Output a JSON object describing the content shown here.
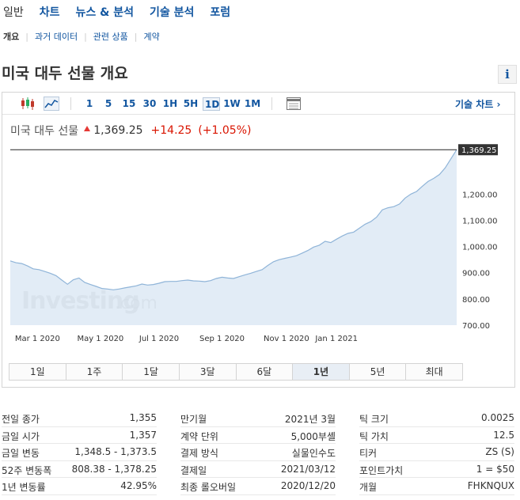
{
  "top_nav": [
    "일반",
    "차트",
    "뉴스 & 분석",
    "기술 분석",
    "포럼"
  ],
  "sub_nav": [
    "개요",
    "과거 데이터",
    "관련 상품",
    "계약"
  ],
  "page_title": "미국 대두 선물 개요",
  "info_label": "i",
  "toolbar": {
    "timeframes": [
      "1",
      "5",
      "15",
      "30",
      "1H",
      "5H",
      "1D",
      "1W",
      "1M"
    ],
    "active_timeframe": "1D",
    "tech_chart_label": "기술 차트 ›"
  },
  "quote": {
    "name": "미국 대두 선물",
    "price": "1,369.25",
    "change": "+14.25",
    "change_pct": "(+1.05%)"
  },
  "colors": {
    "link": "#1256a0",
    "up": "#d91400",
    "area_fill": "#dde9f5",
    "line": "#8fb4d8"
  },
  "chart_data": {
    "type": "area",
    "x_labels": [
      "Mar 1 2020",
      "May 1 2020",
      "Jul 1 2020",
      "Sep 1 2020",
      "Nov 1 2020",
      "Jan 1 2021"
    ],
    "y_ticks": [
      "700.00",
      "800.00",
      "900.00",
      "1,000.00",
      "1,100.00",
      "1,200.00"
    ],
    "ylim": [
      700,
      1370
    ],
    "last_label": "1,369.25",
    "watermark": "Investing.com",
    "series": [
      {
        "values": [
          [
            0,
            945
          ],
          [
            4,
            938
          ],
          [
            8,
            935
          ],
          [
            12,
            926
          ],
          [
            16,
            915
          ],
          [
            20,
            912
          ],
          [
            24,
            905
          ],
          [
            28,
            898
          ],
          [
            32,
            889
          ],
          [
            36,
            872
          ],
          [
            40,
            856
          ],
          [
            44,
            873
          ],
          [
            48,
            880
          ],
          [
            52,
            863
          ],
          [
            56,
            855
          ],
          [
            60,
            848
          ],
          [
            64,
            840
          ],
          [
            68,
            838
          ],
          [
            72,
            835
          ],
          [
            76,
            838
          ],
          [
            80,
            842
          ],
          [
            84,
            846
          ],
          [
            88,
            850
          ],
          [
            92,
            857
          ],
          [
            96,
            853
          ],
          [
            100,
            855
          ],
          [
            104,
            860
          ],
          [
            108,
            866
          ],
          [
            112,
            867
          ],
          [
            116,
            867
          ],
          [
            120,
            870
          ],
          [
            124,
            872
          ],
          [
            128,
            869
          ],
          [
            132,
            868
          ],
          [
            136,
            866
          ],
          [
            140,
            870
          ],
          [
            144,
            878
          ],
          [
            148,
            883
          ],
          [
            152,
            880
          ],
          [
            156,
            878
          ],
          [
            160,
            885
          ],
          [
            164,
            892
          ],
          [
            168,
            898
          ],
          [
            172,
            905
          ],
          [
            176,
            912
          ],
          [
            180,
            928
          ],
          [
            184,
            942
          ],
          [
            188,
            950
          ],
          [
            192,
            955
          ],
          [
            196,
            960
          ],
          [
            200,
            965
          ],
          [
            204,
            975
          ],
          [
            208,
            985
          ],
          [
            212,
            998
          ],
          [
            216,
            1005
          ],
          [
            220,
            1020
          ],
          [
            224,
            1015
          ],
          [
            228,
            1028
          ],
          [
            232,
            1040
          ],
          [
            236,
            1050
          ],
          [
            240,
            1055
          ],
          [
            244,
            1070
          ],
          [
            248,
            1085
          ],
          [
            252,
            1095
          ],
          [
            256,
            1112
          ],
          [
            260,
            1140
          ],
          [
            264,
            1148
          ],
          [
            268,
            1152
          ],
          [
            272,
            1162
          ],
          [
            276,
            1185
          ],
          [
            280,
            1200
          ],
          [
            284,
            1210
          ],
          [
            288,
            1230
          ],
          [
            292,
            1248
          ],
          [
            296,
            1260
          ],
          [
            300,
            1275
          ],
          [
            304,
            1300
          ],
          [
            308,
            1335
          ],
          [
            312,
            1369.25
          ]
        ]
      }
    ],
    "x_ticks_at": [
      19,
      63,
      104,
      148,
      193,
      228
    ],
    "x_max": 312
  },
  "ranges": [
    "1일",
    "1주",
    "1달",
    "3달",
    "6달",
    "1년",
    "5년",
    "최대"
  ],
  "active_range": "1년",
  "stats": {
    "col1": [
      {
        "k": "전일 종가",
        "v": "1,355"
      },
      {
        "k": "금일 시가",
        "v": "1,357"
      },
      {
        "k": "금일 변동",
        "v": "1,348.5 - 1,373.5"
      },
      {
        "k": "52주 변동폭",
        "v": "808.38 - 1,378.25"
      },
      {
        "k": "1년 변동률",
        "v": "42.95%"
      }
    ],
    "col2": [
      {
        "k": "만기월",
        "v": "2021년 3월"
      },
      {
        "k": "계약 단위",
        "v": "5,000부셸"
      },
      {
        "k": "결제 방식",
        "v": "실물인수도"
      },
      {
        "k": "결제일",
        "v": "2021/03/12"
      },
      {
        "k": "최종 롤오버일",
        "v": "2020/12/20"
      }
    ],
    "col3": [
      {
        "k": "틱 크기",
        "v": "0.0025"
      },
      {
        "k": "틱 가치",
        "v": "12.5"
      },
      {
        "k": "티커",
        "v": "ZS (S)"
      },
      {
        "k": "포인트가치",
        "v": "1 = $50"
      },
      {
        "k": "개월",
        "v": "FHKNQUX"
      }
    ]
  }
}
